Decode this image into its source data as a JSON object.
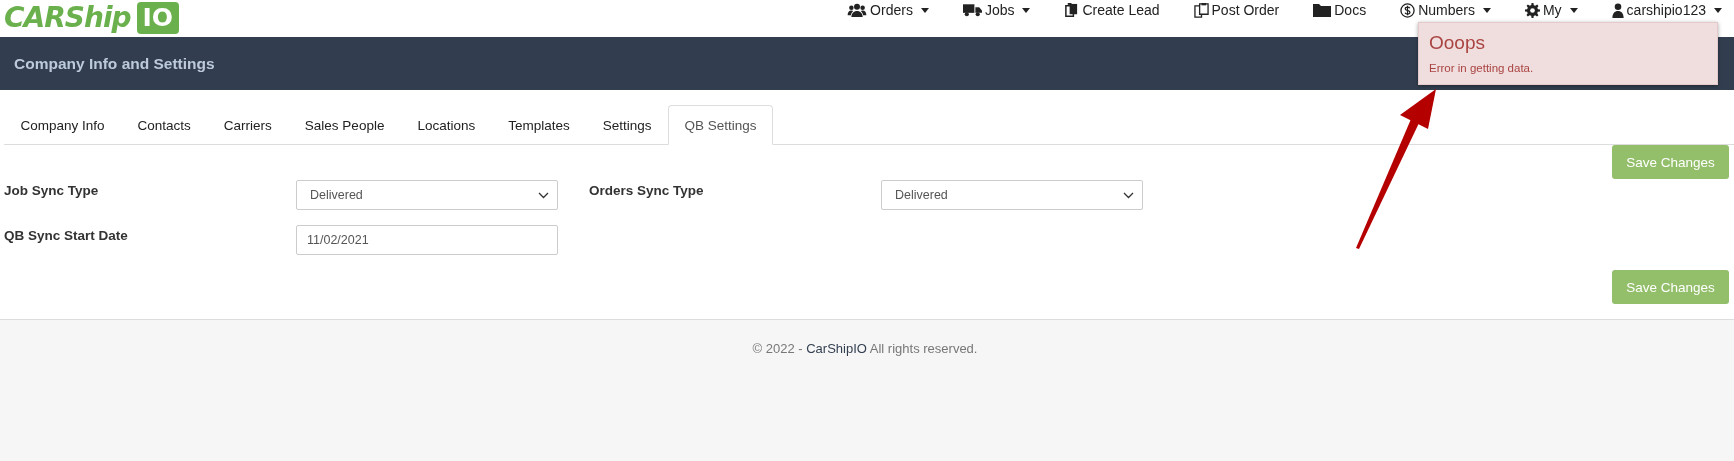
{
  "logo": {
    "text": "CARShip",
    "badge": "IO"
  },
  "nav": [
    {
      "label": "Orders",
      "caret": true
    },
    {
      "label": "Jobs",
      "caret": true
    },
    {
      "label": "Create Lead",
      "caret": false
    },
    {
      "label": "Post Order",
      "caret": false
    },
    {
      "label": "Docs",
      "caret": false
    },
    {
      "label": "Numbers",
      "caret": true
    },
    {
      "label": "My",
      "caret": true
    },
    {
      "label": "carshipio123",
      "caret": true
    }
  ],
  "header": {
    "title": "Company Info and Settings"
  },
  "tabs": [
    {
      "label": "Company Info",
      "selected": false
    },
    {
      "label": "Contacts",
      "selected": false
    },
    {
      "label": "Carriers",
      "selected": false
    },
    {
      "label": "Sales People",
      "selected": false
    },
    {
      "label": "Locations",
      "selected": false
    },
    {
      "label": "Templates",
      "selected": false
    },
    {
      "label": "Settings",
      "selected": false
    },
    {
      "label": "QB Settings",
      "selected": true
    }
  ],
  "save_buttons": [
    "Save Changes",
    "Save Changes"
  ],
  "fields": [
    {
      "kind": "select",
      "label": "Job Sync Type",
      "value": "Delivered"
    },
    {
      "kind": "select",
      "label": "Orders Sync Type",
      "value": "Delivered"
    },
    {
      "kind": "date",
      "label": "QB Sync Start Date",
      "value": "11/02/2021"
    }
  ],
  "footer": {
    "prefix": "© 2022 - ",
    "link": "CarShipIO",
    "suffix": " All rights reserved."
  },
  "toast": {
    "title": "Ooops",
    "message": "Error in getting data."
  }
}
